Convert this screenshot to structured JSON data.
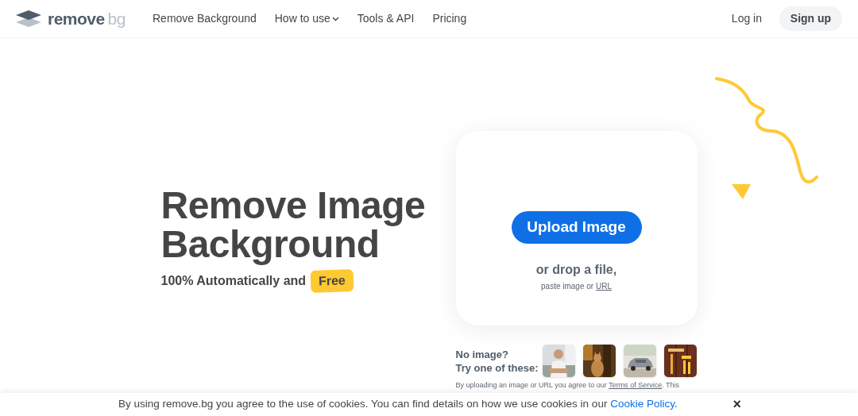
{
  "header": {
    "logo": {
      "word_1": "remove",
      "word_2": "bg"
    },
    "nav": [
      {
        "label": "Remove Background",
        "dropdown": false
      },
      {
        "label": "How to use",
        "dropdown": true
      },
      {
        "label": "Tools & API",
        "dropdown": false
      },
      {
        "label": "Pricing",
        "dropdown": false
      }
    ],
    "login": "Log in",
    "signup": "Sign up"
  },
  "hero": {
    "title_lines": [
      "Remove Image",
      "Background"
    ],
    "subtitle": "100% Automatically and",
    "badge": "Free"
  },
  "upload": {
    "button": "Upload Image",
    "drop_text": "or drop a file,",
    "paste_text": "paste image or",
    "paste_link": "URL"
  },
  "samples": {
    "prompt_lines": [
      "No image?",
      "Try one of these:"
    ]
  },
  "disclaimer": {
    "before": "By uploading an image or URL you agree to our",
    "link": "Terms of Service",
    "after": ". This"
  },
  "cookie_bar": {
    "text": "By using remove.bg you agree to the use of cookies. You can find details on how we use cookies in our",
    "link": "Cookie Policy",
    "after": ".",
    "close": "×"
  }
}
